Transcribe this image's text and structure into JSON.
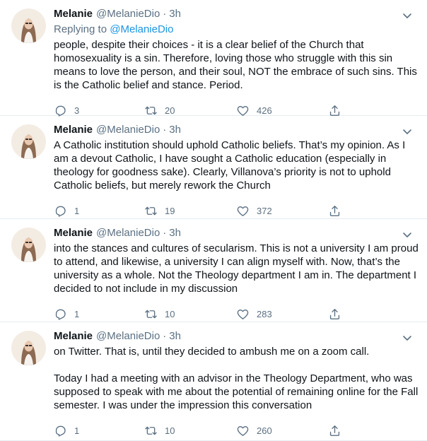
{
  "tweets": [
    {
      "display_name": "Melanie",
      "handle": "@MelanieDio",
      "separator": "·",
      "time": "3h",
      "replying_prefix": "Replying to ",
      "replying_to": "@MelanieDio",
      "text": "people, despite their choices - it is a clear belief of the Church that homosexuality is a sin. Therefore, loving those who struggle with this sin means to love the person, and their soul, NOT the embrace of such sins. This is the Catholic belief and stance. Period.",
      "replies": "3",
      "retweets": "20",
      "likes": "426"
    },
    {
      "display_name": "Melanie",
      "handle": "@MelanieDio",
      "separator": "·",
      "time": "3h",
      "text": "A Catholic institution should uphold Catholic beliefs. That’s my opinion. As I am a devout Catholic, I have sought a Catholic education (especially in theology for goodness sake). Clearly, Villanova’s priority is not to uphold Catholic beliefs, but merely rework the Church",
      "replies": "1",
      "retweets": "19",
      "likes": "372"
    },
    {
      "display_name": "Melanie",
      "handle": "@MelanieDio",
      "separator": "·",
      "time": "3h",
      "text": "into the stances and cultures of secularism. This is not a university I am proud to attend, and likewise, a university I can align myself with. Now, that’s the university as a whole. Not the Theology department I am in. The department I decided to not include in my discussion",
      "replies": "1",
      "retweets": "10",
      "likes": "283"
    },
    {
      "display_name": "Melanie",
      "handle": "@MelanieDio",
      "separator": "·",
      "time": "3h",
      "text": "on Twitter. That is, until they decided to ambush me on a zoom call.\n\nToday I had a meeting with an advisor in the Theology Department, who was supposed to speak with me about the potential of remaining online for the Fall semester. I was under the impression this conversation",
      "replies": "1",
      "retweets": "10",
      "likes": "260"
    }
  ],
  "icons": {
    "reply": "reply-icon",
    "retweet": "retweet-icon",
    "like": "heart-icon",
    "share": "share-icon",
    "caret": "chevron-down-icon"
  },
  "colors": {
    "secondary_text": "#5b7083",
    "link": "#1b95e0",
    "divider": "#e6ecf0"
  }
}
